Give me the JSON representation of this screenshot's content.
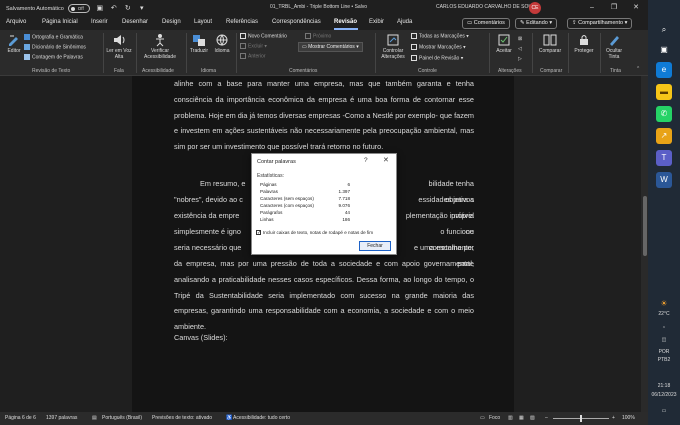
{
  "titlebar": {
    "autosave_label": "Salvamento Automático",
    "autosave_state": "Off",
    "doc_title": "01_TRBL_Ambi - Triple Bottom Line • Salvo",
    "user_name": "CARLOS EDUARDO CARVALHO DE SOUZA",
    "user_initials": "CE"
  },
  "menu": {
    "tabs": [
      "Arquivo",
      "Página Inicial",
      "Inserir",
      "Desenhar",
      "Design",
      "Layout",
      "Referências",
      "Correspondências",
      "Revisão",
      "Exibir",
      "Ajuda"
    ],
    "active_tab": "Revisão",
    "comments_btn": "Comentários",
    "editing_btn": "Editando",
    "share_btn": "Compartilhamento"
  },
  "ribbon": {
    "editor": "Editor",
    "spelling": "Ortografia e Gramática",
    "thesaurus": "Dicionário de Sinônimos",
    "word_count": "Contagem de Palavras",
    "group_text_review": "Revisão de Texto",
    "read_aloud": "Ler em Voz Alta",
    "group_speech": "Fala",
    "check_accessibility": "Verificar Acessibilidade",
    "group_accessibility": "Acessibilidade",
    "translate": "Traduzir",
    "language": "Idioma",
    "group_language": "Idioma",
    "new_comment": "Novo Comentário",
    "delete": "Excluir",
    "previous": "Anterior",
    "next": "Próximo",
    "show_comments": "Mostrar Comentários",
    "group_comments": "Comentários",
    "track_changes": "Controlar Alterações",
    "markup_dropdown": "Todas as Marcações",
    "show_markup": "Mostrar Marcações",
    "review_pane": "Painel de Revisão",
    "group_tracking": "Controle",
    "accept": "Aceitar",
    "group_changes": "Alterações",
    "compare": "Comparar",
    "group_compare": "Comparar",
    "protect": "Proteger",
    "hide_ink": "Ocultar Tinta",
    "group_ink": "Tinta"
  },
  "document": {
    "para1": "alinhe com a base para manter uma empresa, mas que também garanta e tenha consciência da importância econômica da empresa é uma boa forma de contornar esse problema. Hoje em dia já temos diversas empresas -Como a Nestlé por exemplo- que fazem e investem em ações sustentáveis não necessariamente pela preocupação ambiental, mas sim por ser um investimento que possível trará retorno no futuro.",
    "para2_col1": [
      "Em resumo, e",
      "\"nobres\", devido ao c",
      "existência da empre",
      "simplesmente é igno",
      "seria necessário que"
    ],
    "para2_col2": [
      "bilidade tenha objetivos",
      "essidades para a própria",
      "plementação inviável ou",
      "o funcione corretamente,",
      "e uma escolha por parte"
    ],
    "para2_rest": "da empresa, mas por uma pressão de toda a sociedade e com apoio governamental, analisando a praticabilidade nesses casos específicos. Dessa forma, ao longo do tempo, o Tripé da Sustentabilidade seria implementado com sucesso na grande maioria das empresas, garantindo uma responsabilidade com a economia, a sociedade e com o meio ambiente.",
    "para3": "Canvas (Slides):"
  },
  "dialog": {
    "title": "Contar palavras",
    "help": "?",
    "close": "✕",
    "section": "Estatísticas:",
    "stats": [
      {
        "label": "Páginas",
        "value": "6"
      },
      {
        "label": "Palavras",
        "value": "1.397"
      },
      {
        "label": "Caracteres (sem espaços)",
        "value": "7.718"
      },
      {
        "label": "Caracteres (com espaços)",
        "value": "9.076"
      },
      {
        "label": "Parágrafos",
        "value": "44"
      },
      {
        "label": "Linhas",
        "value": "186"
      }
    ],
    "checkbox_label": "Incluir caixas de texto, notas de rodapé e notas de fim",
    "checkbox_checked": true,
    "close_button": "Fechar"
  },
  "statusbar": {
    "page": "Página 6 de 6",
    "words": "1397 palavras",
    "language": "Português (Brasil)",
    "predictions": "Previsões de texto: ativado",
    "accessibility": "Acessibilidade: tudo certo",
    "focus": "Foco",
    "zoom": "100%"
  },
  "taskbar": {
    "weather_temp": "22°C",
    "lang_line1": "POR",
    "lang_line2": "PTB2",
    "time": "21:18",
    "date": "06/12/2023"
  },
  "colors": {
    "accent": "#8ab4f8",
    "avatar": "#c43a3a",
    "dialog_button_border": "#1e62c7"
  }
}
